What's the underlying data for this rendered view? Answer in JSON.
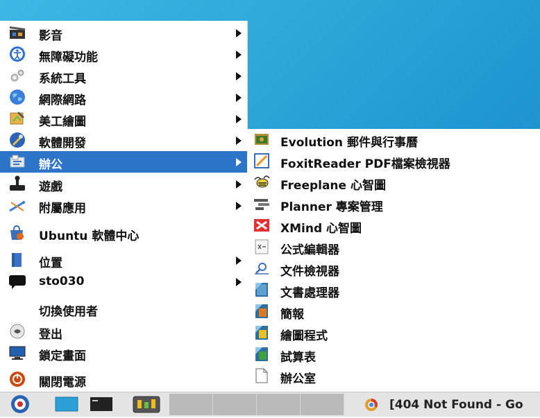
{
  "menu": {
    "items": [
      {
        "label": "影音",
        "icon": "multimedia-icon",
        "submenu": true
      },
      {
        "label": "無障礙功能",
        "icon": "accessibility-icon",
        "submenu": true
      },
      {
        "label": "系統工具",
        "icon": "system-tools-icon",
        "submenu": true
      },
      {
        "label": "網際網路",
        "icon": "internet-globe-icon",
        "submenu": true
      },
      {
        "label": "美工繪圖",
        "icon": "graphics-icon",
        "submenu": true
      },
      {
        "label": "軟體開發",
        "icon": "development-icon",
        "submenu": true
      },
      {
        "label": "辦公",
        "icon": "office-icon",
        "submenu": true,
        "selected": true
      },
      {
        "label": "遊戲",
        "icon": "joystick-icon",
        "submenu": true
      },
      {
        "label": "附屬應用",
        "icon": "accessories-icon",
        "submenu": true
      },
      {
        "label": "Ubuntu 軟體中心",
        "icon": "software-center-icon",
        "submenu": false
      },
      {
        "label": "位置",
        "icon": "places-folder-icon",
        "submenu": true
      },
      {
        "label": "sto030",
        "icon": "chat-bubble-icon",
        "submenu": true
      },
      {
        "label": "切換使用者",
        "icon": "",
        "submenu": false
      },
      {
        "label": "登出",
        "icon": "logout-icon",
        "submenu": false
      },
      {
        "label": "鎖定畫面",
        "icon": "lock-screen-icon",
        "submenu": false
      },
      {
        "label": "關閉電源",
        "icon": "power-icon",
        "submenu": false
      }
    ]
  },
  "submenu": {
    "items": [
      {
        "label": "Evolution 郵件與行事曆",
        "icon": "evolution-icon"
      },
      {
        "label": "FoxitReader PDF檔案檢視器",
        "icon": "foxit-reader-icon"
      },
      {
        "label": "Freeplane 心智圖",
        "icon": "freeplane-icon"
      },
      {
        "label": "Planner 專案管理",
        "icon": "planner-icon"
      },
      {
        "label": "XMind 心智圖",
        "icon": "xmind-icon"
      },
      {
        "label": "公式編輯器",
        "icon": "formula-icon"
      },
      {
        "label": "文件檢視器",
        "icon": "document-viewer-icon"
      },
      {
        "label": "文書處理器",
        "icon": "writer-icon"
      },
      {
        "label": "簡報",
        "icon": "presentation-icon"
      },
      {
        "label": "繪圖程式",
        "icon": "draw-icon"
      },
      {
        "label": "試算表",
        "icon": "spreadsheet-icon"
      },
      {
        "label": "辦公室",
        "icon": "blank-document-icon"
      }
    ]
  },
  "taskbar": {
    "window_title": "[404 Not Found - Go",
    "icons": [
      "start-menu-icon",
      "show-desktop-icon",
      "terminal-icon",
      "system-monitor-icon"
    ]
  },
  "colors": {
    "selection": "#2d74c8",
    "desktop": "#2fa8da"
  }
}
